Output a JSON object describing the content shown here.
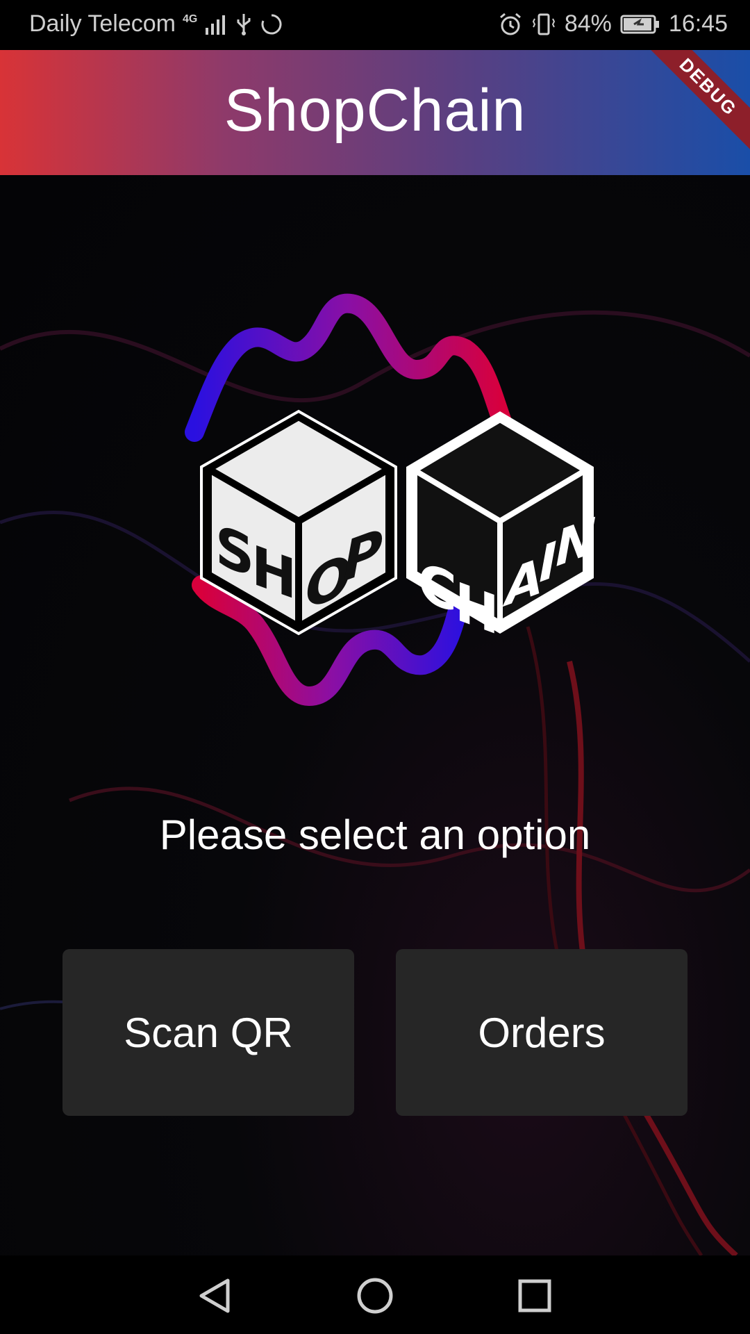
{
  "status_bar": {
    "carrier": "Daily Telecom",
    "network": "4G",
    "battery": "84%",
    "time": "16:45",
    "icons": [
      "signal-icon",
      "usb-icon",
      "sync-icon",
      "alarm-icon",
      "vibrate-icon",
      "battery-charging-icon"
    ]
  },
  "app_bar": {
    "title": "ShopChain",
    "banner": "DEBUG"
  },
  "logo": {
    "left_cube_letters": [
      "S",
      "H",
      "O",
      "P"
    ],
    "right_cube_letters": [
      "C",
      "H",
      "A",
      "I",
      "N"
    ]
  },
  "main": {
    "prompt": "Please select an option",
    "buttons": [
      {
        "label": "Scan QR"
      },
      {
        "label": "Orders"
      }
    ]
  },
  "nav_bar": {
    "icons": [
      "back-icon",
      "home-icon",
      "recents-icon"
    ]
  },
  "colors": {
    "accent_red": "#d83337",
    "accent_blue": "#1a4ea8",
    "button_bg": "#262626"
  }
}
